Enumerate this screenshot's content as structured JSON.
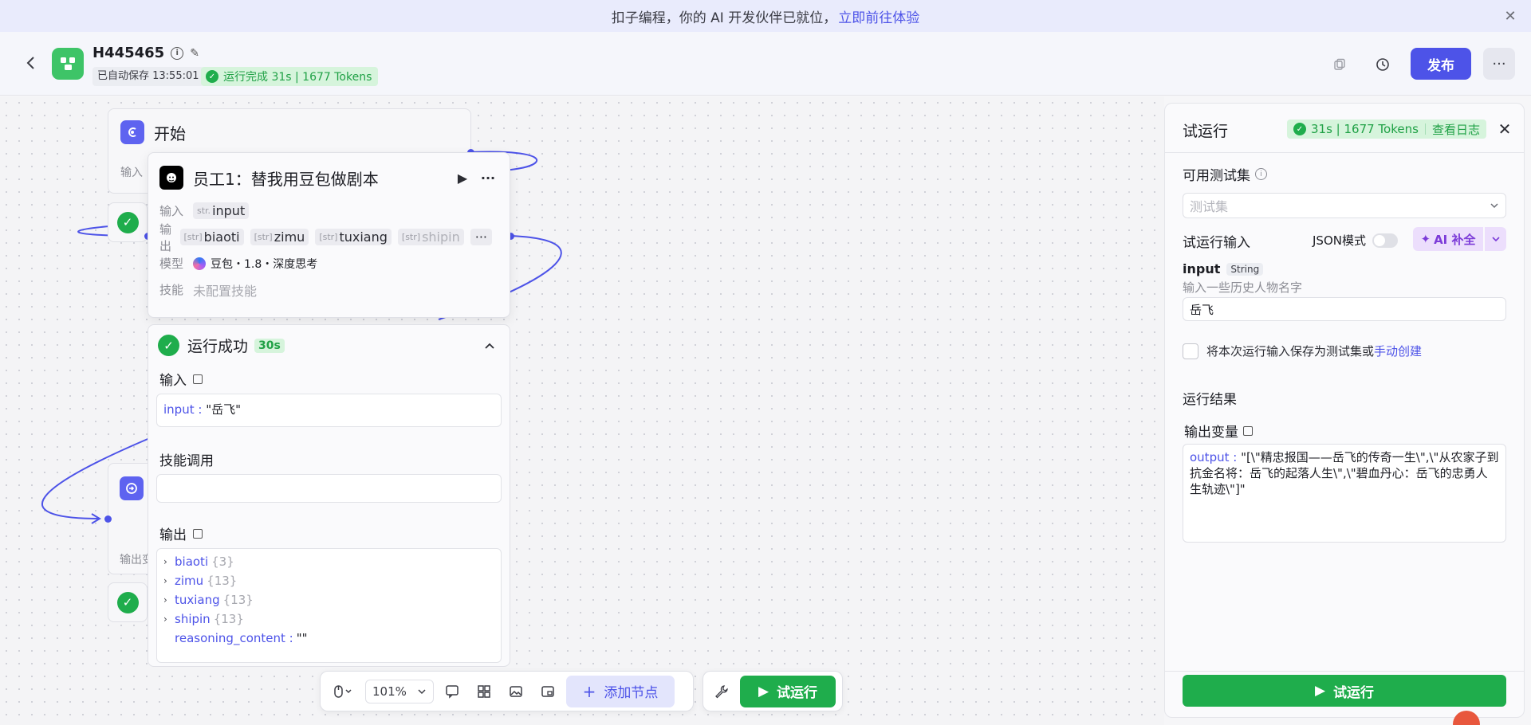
{
  "banner": {
    "text": "扣子编程，你的 AI 开发伙伴已就位，",
    "link": "立即前往体验"
  },
  "header": {
    "title": "H445465",
    "autosave": "已自动保存 13:55:01",
    "run_status": "运行完成 31s | 1677 Tokens",
    "publish": "发布"
  },
  "start_node": {
    "title": "开始",
    "input_label": "输入"
  },
  "llm_node": {
    "title": "员工1：替我用豆包做剧本",
    "input_key": "输入",
    "input_type": "str.",
    "input_name": "input",
    "output_key": "输出",
    "outputs": [
      {
        "type": "[str]",
        "name": "biaoti"
      },
      {
        "type": "[str]",
        "name": "zimu"
      },
      {
        "type": "[str]",
        "name": "tuxiang"
      },
      {
        "type": "[str]",
        "name": "shipin"
      }
    ],
    "model_key": "模型",
    "model": "豆包・1.8・深度思考",
    "skill_key": "技能",
    "skill": "未配置技能"
  },
  "result_card": {
    "title": "运行成功",
    "time": "30s",
    "input_label": "输入",
    "input_key": "input :",
    "input_value": "\"岳飞\"",
    "skill_label": "技能调用",
    "output_label": "输出",
    "outputs": [
      {
        "name": "biaoti",
        "count": "{3}"
      },
      {
        "name": "zimu",
        "count": "{13}"
      },
      {
        "name": "tuxiang",
        "count": "{13}"
      },
      {
        "name": "shipin",
        "count": "{13}"
      }
    ],
    "reasoning_key": "reasoning_content :",
    "reasoning_value": "\"\""
  },
  "end_node": {
    "label": "输出变"
  },
  "toolbar": {
    "zoom": "101%",
    "add_node": "添加节点",
    "run": "试运行"
  },
  "panel": {
    "title": "试运行",
    "status_text": "31s | 1677 Tokens",
    "log_link": "查看日志",
    "testset_label": "可用测试集",
    "testset_placeholder": "测试集",
    "run_input_label": "试运行输入",
    "json_mode": "JSON模式",
    "ai_fill": "AI 补全",
    "var_name": "input",
    "var_type": "String",
    "var_desc": "输入一些历史人物名字",
    "var_value": "岳飞",
    "save_text": "将本次运行输入保存为测试集或",
    "manual_create": "手动创建",
    "result_label": "运行结果",
    "output_var_label": "输出变量",
    "output_key": "output :",
    "output_value": "\"[\\\"精忠报国——岳飞的传奇一生\\\",\\\"从农家子到抗金名将：岳飞的起落人生\\\",\\\"碧血丹心：岳飞的忠勇人生轨迹\\\"]\"",
    "run_button": "试运行"
  },
  "icons": {
    "close": "close-icon",
    "back": "chevron-left-icon",
    "info": "info-icon",
    "edit": "edit-icon",
    "check": "check-circle-icon",
    "play": "play-icon",
    "more": "more-icon",
    "history": "history-icon",
    "copy": "copy-icon"
  },
  "colors": {
    "brand": "#4d53e8",
    "success": "#1fad4c",
    "success_bg": "#d6f4dc",
    "ai_purple": "#7c3bd8",
    "app_icon": "#3ec467"
  }
}
